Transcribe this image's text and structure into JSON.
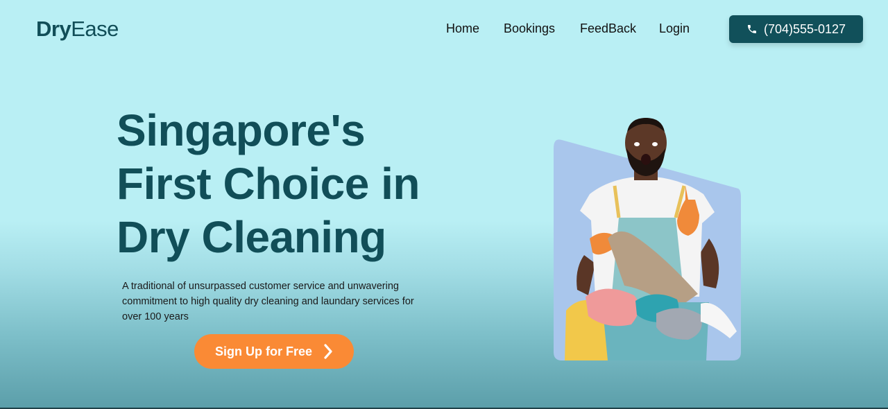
{
  "brand": {
    "name_bold": "Dry",
    "name_light": "Ease"
  },
  "nav": {
    "home": "Home",
    "bookings": "Bookings",
    "feedback": "FeedBack",
    "login": "Login"
  },
  "contact": {
    "phone": "(704)555-0127",
    "icon": "phone-icon"
  },
  "hero": {
    "headline_lines": [
      "Singapore's",
      "First Choice in",
      "Dry Cleaning"
    ],
    "description": "A traditional of unsurpassed customer service and unwavering commitment to high quality dry cleaning and laundary services for over 100 years",
    "cta_label": "Sign Up for Free",
    "cta_icon": "chevron-right-icon"
  },
  "colors": {
    "brand_dark": "#114e58",
    "accent_orange": "#fa8a35",
    "background_light": "#b9eff4"
  }
}
